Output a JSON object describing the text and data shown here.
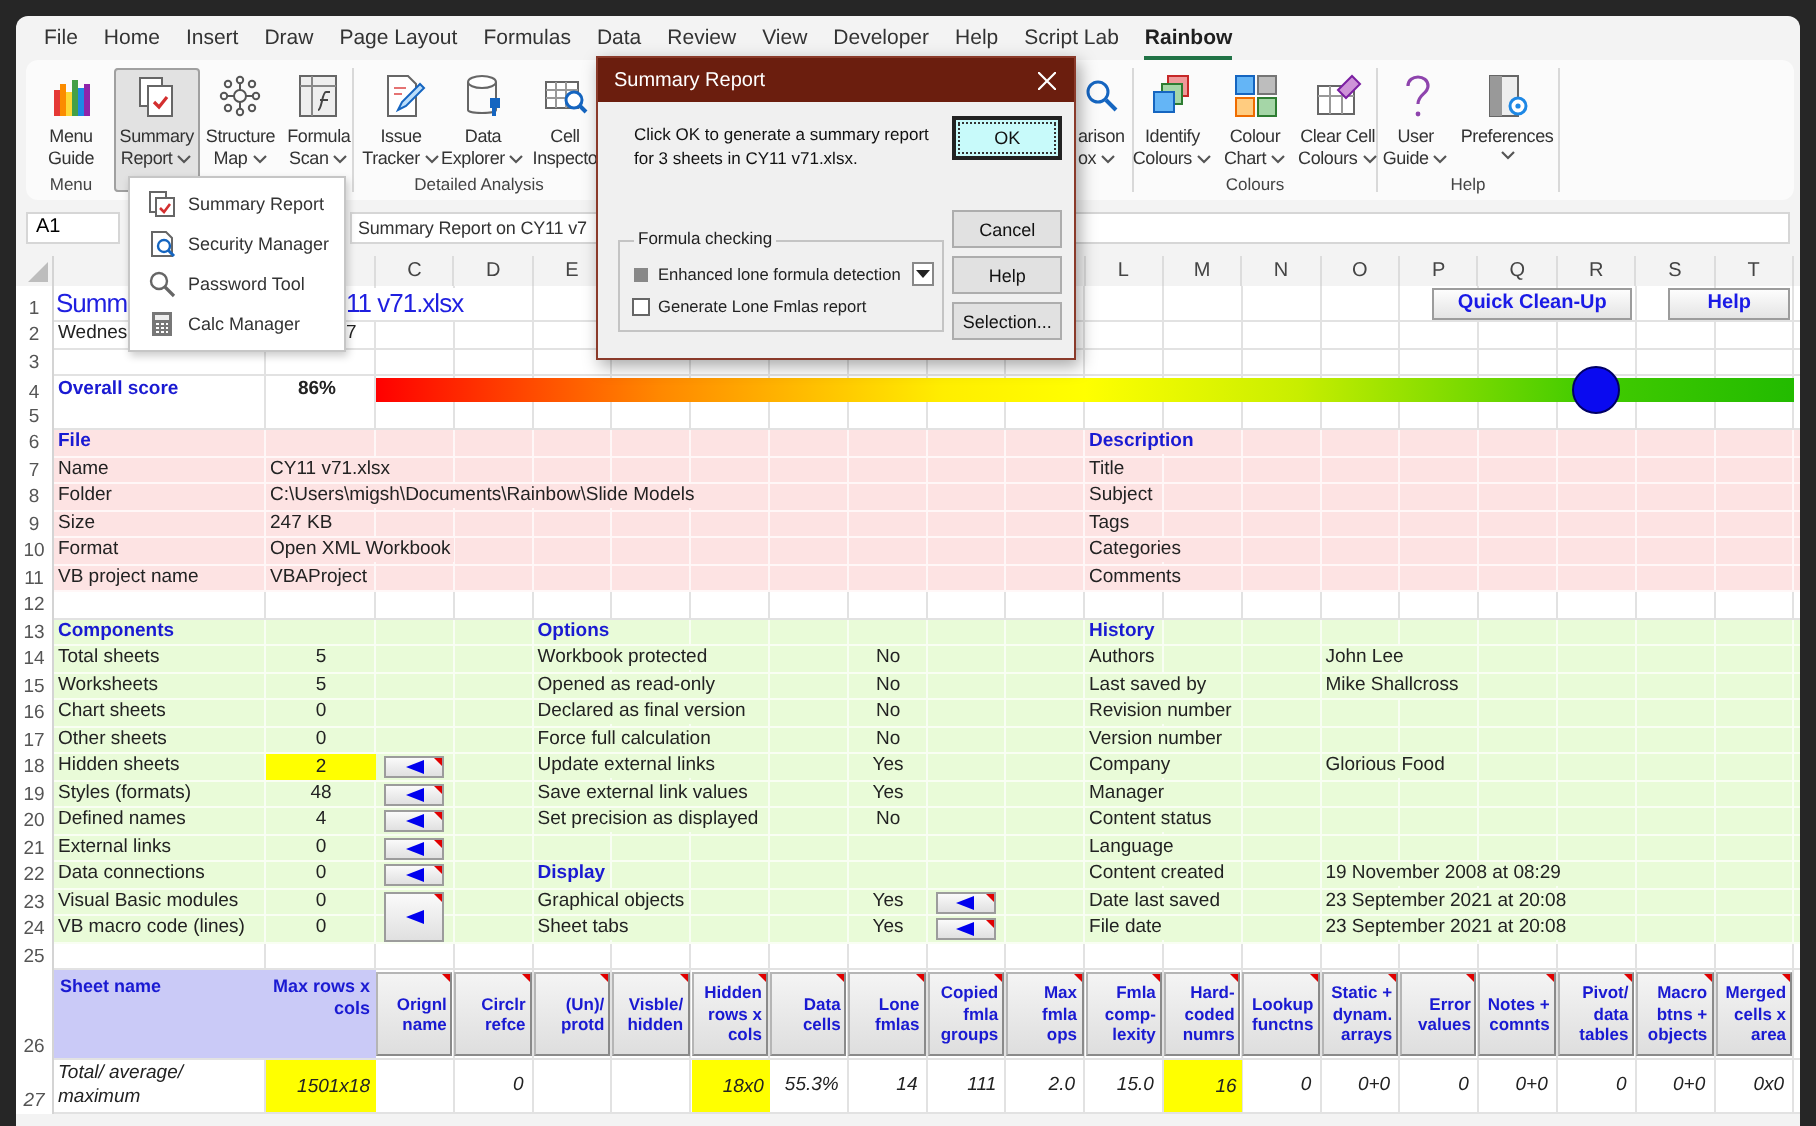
{
  "tabs": [
    {
      "label": "File",
      "selected": false
    },
    {
      "label": "Home",
      "selected": false
    },
    {
      "label": "Insert",
      "selected": false
    },
    {
      "label": "Draw",
      "selected": false
    },
    {
      "label": "Page Layout",
      "selected": false
    },
    {
      "label": "Formulas",
      "selected": false
    },
    {
      "label": "Data",
      "selected": false
    },
    {
      "label": "Review",
      "selected": false
    },
    {
      "label": "View",
      "selected": false
    },
    {
      "label": "Developer",
      "selected": false
    },
    {
      "label": "Help",
      "selected": false
    },
    {
      "label": "Script Lab",
      "selected": false
    },
    {
      "label": "Rainbow",
      "selected": true
    }
  ],
  "ribbon": {
    "groups": [
      {
        "label": "Menu",
        "buttons": [
          {
            "lines": [
              "Menu",
              "Guide"
            ],
            "dropdown": false,
            "selected": false
          }
        ]
      },
      {
        "buttons": [
          {
            "lines": [
              "Summary",
              "Report"
            ],
            "dropdown": true,
            "selected": true
          },
          {
            "lines": [
              "Structure",
              "Map"
            ],
            "dropdown": true,
            "selected": false
          },
          {
            "lines": [
              "Formula",
              "Scan"
            ],
            "dropdown": true,
            "selected": false
          }
        ]
      },
      {
        "label": "Detailed Analysis",
        "buttons": [
          {
            "lines": [
              "Issue",
              "Tracker"
            ],
            "dropdown": true,
            "selected": false
          },
          {
            "lines": [
              "Data",
              "Explorer"
            ],
            "dropdown": true,
            "selected": false
          },
          {
            "lines": [
              "Cell",
              "Inspecto"
            ],
            "dropdown": false,
            "selected": false
          }
        ]
      },
      {
        "buttons": [
          {
            "lines": [
              "arison",
              "ox"
            ],
            "dropdown": true,
            "selected": false
          }
        ]
      },
      {
        "label": "Colours",
        "buttons": [
          {
            "lines": [
              "Identify",
              "Colours"
            ],
            "dropdown": true,
            "selected": false
          },
          {
            "lines": [
              "Colour",
              "Chart"
            ],
            "dropdown": true,
            "selected": false
          },
          {
            "lines": [
              "Clear Cell",
              "Colours"
            ],
            "dropdown": true,
            "selected": false
          }
        ]
      },
      {
        "label": "Help",
        "buttons": [
          {
            "lines": [
              "User",
              "Guide"
            ],
            "dropdown": true,
            "selected": false
          },
          {
            "lines": [
              "Preferences"
            ],
            "dropdown": true,
            "selected": false
          }
        ]
      }
    ]
  },
  "formula_bar": {
    "cell_ref": "A1",
    "formula": "Summary Report on CY11 v7"
  },
  "sheet": {
    "column_headers": {
      "C": "C",
      "D": "D",
      "E": "E",
      "L": "L",
      "M": "M",
      "N": "N",
      "O": "O",
      "P": "P",
      "Q": "Q",
      "R": "R",
      "S": "S",
      "T": "T"
    },
    "rows": [
      {
        "number": "1",
        "kind": "title",
        "cells": {
          "A": {
            "text": "Summ",
            "kind": "title"
          },
          "B": {
            "text": "11 v71.xlsx",
            "kind": "title-continued"
          },
          "P": {
            "text": "Quick Clean-Up",
            "kind": "sheet-button"
          },
          "S": {
            "text": "Help",
            "kind": "sheet-button"
          }
        }
      },
      {
        "number": "2",
        "kind": "plain",
        "cells": {
          "A": {
            "text": "Wednes",
            "kind": "text"
          },
          "B": {
            "text": "7",
            "kind": "text-continued"
          }
        }
      },
      {
        "number": "3",
        "kind": "plain",
        "cells": {}
      },
      {
        "number": "4",
        "kind": "plain",
        "cells": {
          "A": {
            "text": "Overall score",
            "kind": "heading"
          },
          "B": {
            "text": "86%",
            "kind": "score-value"
          },
          "C": {
            "kind": "score-bar",
            "level": 0.86
          }
        }
      },
      {
        "number": "5",
        "kind": "plain",
        "cells": {}
      },
      {
        "number": "6",
        "kind": "file",
        "cells": {
          "A": {
            "text": "File",
            "kind": "heading"
          },
          "L": {
            "text": "Description",
            "kind": "heading"
          }
        }
      },
      {
        "number": "7",
        "kind": "file",
        "cells": {
          "A": {
            "text": "Name",
            "kind": "text"
          },
          "B": {
            "text": "CY11 v71.xlsx",
            "kind": "text"
          },
          "L": {
            "text": "Title",
            "kind": "text"
          }
        }
      },
      {
        "number": "8",
        "kind": "file",
        "cells": {
          "A": {
            "text": "Folder",
            "kind": "text"
          },
          "B": {
            "text": "C:\\Users\\migsh\\Documents\\Rainbow\\Slide Models",
            "kind": "text"
          },
          "L": {
            "text": "Subject",
            "kind": "text"
          }
        }
      },
      {
        "number": "9",
        "kind": "file",
        "cells": {
          "A": {
            "text": "Size",
            "kind": "text"
          },
          "B": {
            "text": "247 KB",
            "kind": "text"
          },
          "L": {
            "text": "Tags",
            "kind": "text"
          }
        }
      },
      {
        "number": "10",
        "kind": "file",
        "cells": {
          "A": {
            "text": "Format",
            "kind": "text"
          },
          "B": {
            "text": "Open XML Workbook",
            "kind": "text"
          },
          "L": {
            "text": "Categories",
            "kind": "text"
          }
        }
      },
      {
        "number": "11",
        "kind": "file",
        "cells": {
          "A": {
            "text": "VB project name",
            "kind": "text"
          },
          "B": {
            "text": "VBAProject",
            "kind": "text"
          },
          "L": {
            "text": "Comments",
            "kind": "text"
          }
        }
      },
      {
        "number": "12",
        "kind": "plain",
        "cells": {}
      },
      {
        "number": "13",
        "kind": "summary",
        "cells": {
          "A": {
            "text": "Components",
            "kind": "heading"
          },
          "E": {
            "text": "Options",
            "kind": "heading"
          },
          "L": {
            "text": "History",
            "kind": "heading"
          }
        }
      },
      {
        "number": "14",
        "kind": "summary",
        "cells": {
          "A": {
            "text": "Total sheets",
            "kind": "text"
          },
          "B": {
            "text": "5",
            "kind": "value"
          },
          "E": {
            "text": "Workbook protected",
            "kind": "text"
          },
          "I": {
            "text": "No",
            "kind": "value"
          },
          "L": {
            "text": "Authors",
            "kind": "text"
          },
          "O": {
            "text": "John Lee",
            "kind": "text"
          }
        }
      },
      {
        "number": "15",
        "kind": "summary",
        "cells": {
          "A": {
            "text": "Worksheets",
            "kind": "text"
          },
          "B": {
            "text": "5",
            "kind": "value"
          },
          "E": {
            "text": "Opened as read-only",
            "kind": "text"
          },
          "I": {
            "text": "No",
            "kind": "value"
          },
          "L": {
            "text": "Last saved by",
            "kind": "text"
          },
          "O": {
            "text": "Mike Shallcross",
            "kind": "text"
          }
        }
      },
      {
        "number": "16",
        "kind": "summary",
        "cells": {
          "A": {
            "text": "Chart sheets",
            "kind": "text"
          },
          "B": {
            "text": "0",
            "kind": "value"
          },
          "E": {
            "text": "Declared as final version",
            "kind": "text"
          },
          "I": {
            "text": "No",
            "kind": "value"
          },
          "L": {
            "text": "Revision number",
            "kind": "text"
          }
        }
      },
      {
        "number": "17",
        "kind": "summary",
        "cells": {
          "A": {
            "text": "Other sheets",
            "kind": "text"
          },
          "B": {
            "text": "0",
            "kind": "value"
          },
          "E": {
            "text": "Force full calculation",
            "kind": "text"
          },
          "I": {
            "text": "No",
            "kind": "value"
          },
          "L": {
            "text": "Version number",
            "kind": "text"
          }
        }
      },
      {
        "number": "18",
        "kind": "summary",
        "cells": {
          "A": {
            "text": "Hidden sheets",
            "kind": "text"
          },
          "B": {
            "text": "2",
            "kind": "value-flagged"
          },
          "C": {
            "kind": "arrow-button"
          },
          "E": {
            "text": "Update external links",
            "kind": "text"
          },
          "I": {
            "text": "Yes",
            "kind": "value"
          },
          "L": {
            "text": "Company",
            "kind": "text"
          },
          "O": {
            "text": "Glorious Food",
            "kind": "text"
          }
        }
      },
      {
        "number": "19",
        "kind": "summary",
        "cells": {
          "A": {
            "text": "Styles (formats)",
            "kind": "text"
          },
          "B": {
            "text": "48",
            "kind": "value"
          },
          "C": {
            "kind": "arrow-button"
          },
          "E": {
            "text": "Save external link values",
            "kind": "text"
          },
          "I": {
            "text": "Yes",
            "kind": "value"
          },
          "L": {
            "text": "Manager",
            "kind": "text"
          }
        }
      },
      {
        "number": "20",
        "kind": "summary",
        "cells": {
          "A": {
            "text": "Defined names",
            "kind": "text"
          },
          "B": {
            "text": "4",
            "kind": "value"
          },
          "C": {
            "kind": "arrow-button"
          },
          "E": {
            "text": "Set precision as displayed",
            "kind": "text"
          },
          "I": {
            "text": "No",
            "kind": "value"
          },
          "L": {
            "text": "Content status",
            "kind": "text"
          }
        }
      },
      {
        "number": "21",
        "kind": "summary",
        "cells": {
          "A": {
            "text": "External links",
            "kind": "text"
          },
          "B": {
            "text": "0",
            "kind": "value"
          },
          "C": {
            "kind": "arrow-button"
          },
          "L": {
            "text": "Language",
            "kind": "text"
          }
        }
      },
      {
        "number": "22",
        "kind": "summary",
        "cells": {
          "A": {
            "text": "Data connections",
            "kind": "text"
          },
          "B": {
            "text": "0",
            "kind": "value"
          },
          "C": {
            "kind": "arrow-button"
          },
          "E": {
            "text": "Display",
            "kind": "heading"
          },
          "L": {
            "text": "Content created",
            "kind": "text"
          },
          "O": {
            "text": "19 November 2008 at 08:29",
            "kind": "text"
          }
        }
      },
      {
        "number": "23",
        "kind": "summary",
        "cells": {
          "A": {
            "text": "Visual Basic modules",
            "kind": "text"
          },
          "B": {
            "text": "0",
            "kind": "value"
          },
          "C": {
            "kind": "arrow-button-tall"
          },
          "E": {
            "text": "Graphical objects",
            "kind": "text"
          },
          "I": {
            "text": "Yes",
            "kind": "value"
          },
          "J": {
            "kind": "arrow-button"
          },
          "L": {
            "text": "Date last saved",
            "kind": "text"
          },
          "O": {
            "text": "23 September 2021 at 20:08",
            "kind": "text"
          }
        }
      },
      {
        "number": "24",
        "kind": "summary",
        "cells": {
          "A": {
            "text": "VB macro code (lines)",
            "kind": "text"
          },
          "B": {
            "text": "0",
            "kind": "value"
          },
          "E": {
            "text": "Sheet tabs",
            "kind": "text"
          },
          "I": {
            "text": "Yes",
            "kind": "value"
          },
          "J": {
            "kind": "arrow-button"
          },
          "L": {
            "text": "File date",
            "kind": "text"
          },
          "O": {
            "text": "23 September 2021 at 20:08",
            "kind": "text"
          }
        }
      },
      {
        "number": "25",
        "kind": "plain",
        "cells": {}
      },
      {
        "number": "26",
        "kind": "header",
        "cells": {
          "A": {
            "text": "Sheet name",
            "kind": "list-heading"
          },
          "B": {
            "text": "Max rows x cols",
            "kind": "list-heading-right"
          },
          "C": {
            "text": "Orignl name",
            "kind": "column-button"
          },
          "D": {
            "text": "Circlr refce",
            "kind": "column-button"
          },
          "E": {
            "text": "(Un)/ protd",
            "kind": "column-button"
          },
          "F": {
            "text": "Visble/ hidden",
            "kind": "column-button"
          },
          "G": {
            "text": "Hidden rows x cols",
            "kind": "column-button"
          },
          "H": {
            "text": "Data cells",
            "kind": "column-button"
          },
          "I": {
            "text": "Lone fmlas",
            "kind": "column-button"
          },
          "J": {
            "text": "Copied fmla groups",
            "kind": "column-button"
          },
          "K": {
            "text": "Max fmla ops",
            "kind": "column-button"
          },
          "L": {
            "text": "Fmla comp-lexity",
            "kind": "column-button"
          },
          "M": {
            "text": "Hard-coded numrs",
            "kind": "column-button"
          },
          "N": {
            "text": "Lookup functns",
            "kind": "column-button"
          },
          "O": {
            "text": "Static + dynam. arrays",
            "kind": "column-button"
          },
          "P": {
            "text": "Error values",
            "kind": "column-button"
          },
          "Q": {
            "text": "Notes + comnts",
            "kind": "column-button"
          },
          "R": {
            "text": "Pivot/ data tables",
            "kind": "column-button"
          },
          "S": {
            "text": "Macro btns + objects",
            "kind": "column-button"
          },
          "T": {
            "text": "Merged cells x area",
            "kind": "column-button"
          }
        }
      },
      {
        "number": "27",
        "kind": "totals",
        "cells": {
          "A": {
            "text": "Total/ average/ maximum",
            "kind": "text-wrap"
          },
          "B": {
            "text": "1501x18",
            "kind": "number-flagged"
          },
          "D": {
            "text": "0",
            "kind": "number"
          },
          "G": {
            "text": "18x0",
            "kind": "number-flagged"
          },
          "H": {
            "text": "55.3%",
            "kind": "number"
          },
          "I": {
            "text": "14",
            "kind": "number"
          },
          "J": {
            "text": "111",
            "kind": "number"
          },
          "K": {
            "text": "2.0",
            "kind": "number"
          },
          "L": {
            "text": "15.0",
            "kind": "number"
          },
          "M": {
            "text": "16",
            "kind": "number-flagged"
          },
          "N": {
            "text": "0",
            "kind": "number"
          },
          "O": {
            "text": "0+0",
            "kind": "number"
          },
          "P": {
            "text": "0",
            "kind": "number"
          },
          "Q": {
            "text": "0+0",
            "kind": "number"
          },
          "R": {
            "text": "0",
            "kind": "number"
          },
          "S": {
            "text": "0+0",
            "kind": "number"
          },
          "T": {
            "text": "0x0",
            "kind": "number"
          }
        }
      }
    ]
  },
  "dropdown_menu": {
    "items": [
      "Summary Report",
      "Security Manager",
      "Password Tool",
      "Calc Manager"
    ]
  },
  "dialog": {
    "title": "Summary Report",
    "message": "Click OK to generate a summary report for 3 sheets in CY11 v71.xlsx.",
    "group": {
      "label": "Formula checking",
      "options": [
        {
          "label": "Enhanced lone formula detection",
          "kind": "dropdown",
          "checked": false,
          "indeterminate": true
        },
        {
          "label": "Generate Lone Fmlas report",
          "kind": "checkbox",
          "checked": false,
          "indeterminate": false
        }
      ]
    },
    "buttons": [
      {
        "label": "OK",
        "default": true
      },
      {
        "label": "Cancel",
        "default": false
      },
      {
        "label": "Help",
        "default": false
      },
      {
        "label": "Selection...",
        "default": false
      }
    ]
  }
}
